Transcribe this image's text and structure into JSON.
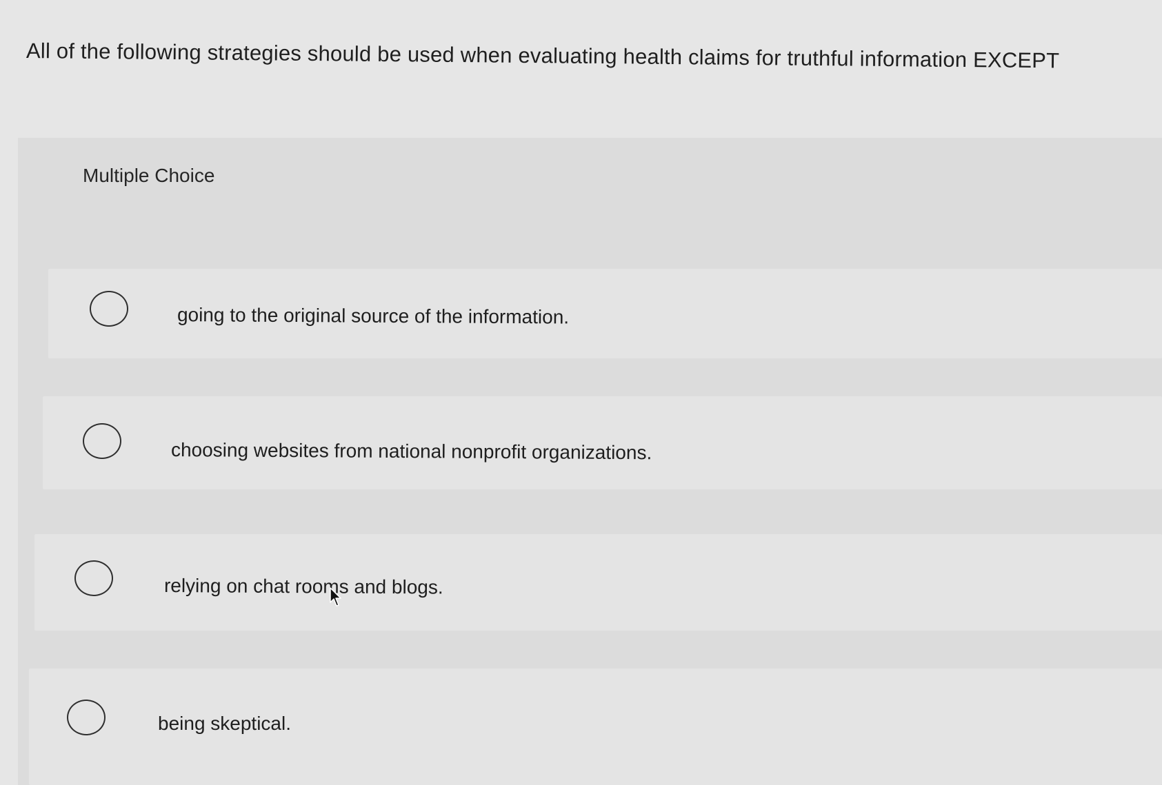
{
  "question": {
    "text": "All of the following strategies should be used when evaluating health claims for truthful information EXCEPT"
  },
  "section": {
    "label": "Multiple Choice"
  },
  "options": [
    {
      "text": "going to the original source of the information."
    },
    {
      "text": "choosing websites from national nonprofit organizations."
    },
    {
      "text": "relying on chat rooms and blogs."
    },
    {
      "text": "being skeptical."
    }
  ],
  "colors": {
    "background": "#e6e6e6",
    "panel": "#dcdcdc",
    "option_row": "#e4e4e4",
    "text": "#1f1f1f",
    "radio_border": "#2f2f2f"
  },
  "icons": {
    "radio": "radio-button-unselected-icon",
    "cursor": "mouse-pointer-icon"
  }
}
